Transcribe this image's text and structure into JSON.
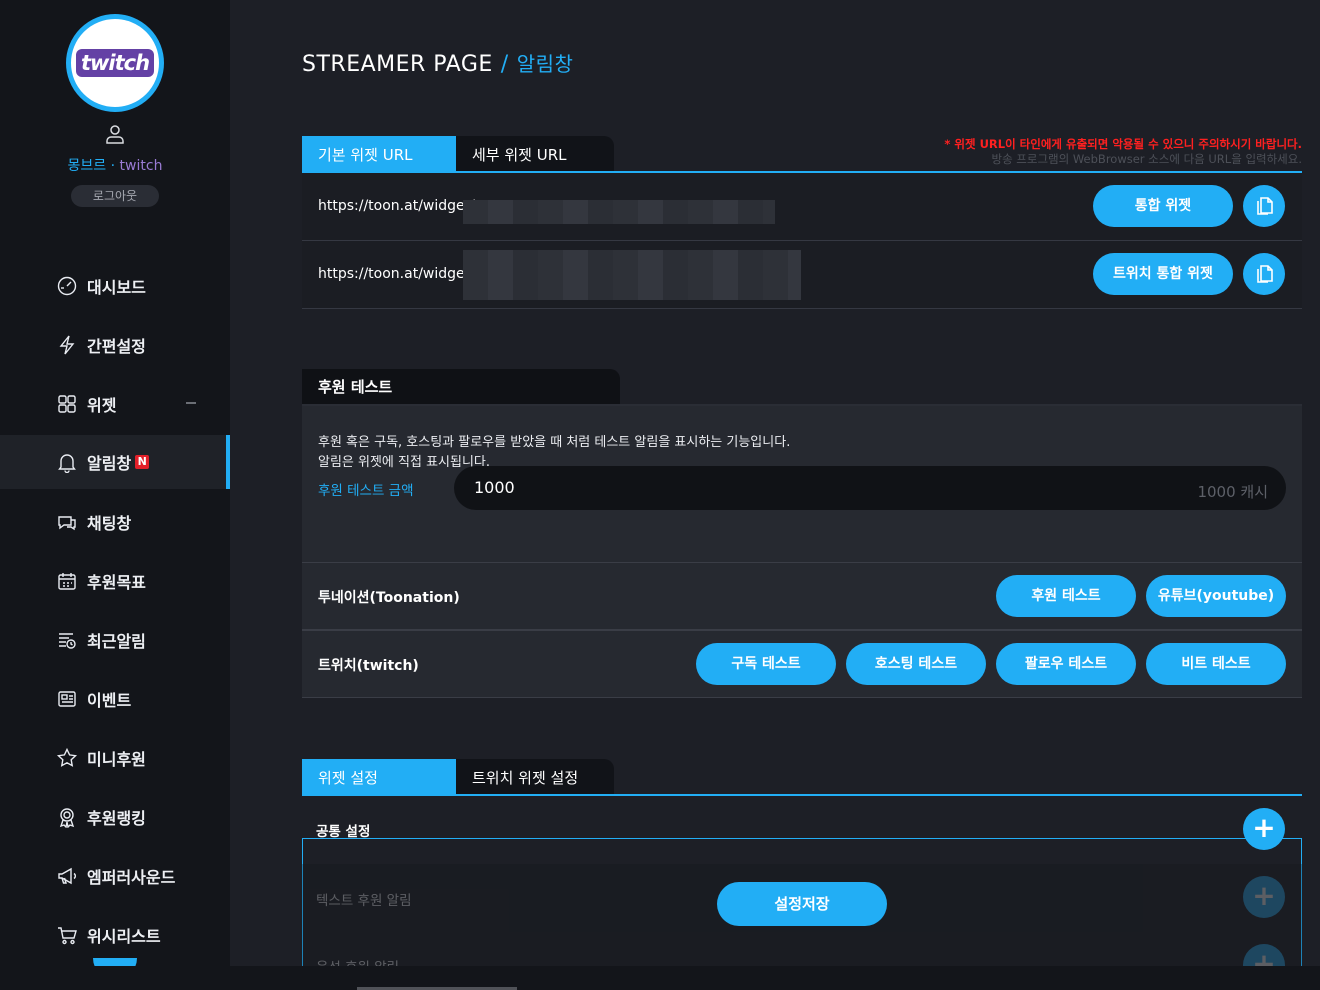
{
  "brand": {
    "logo_text": "twitch",
    "accent": "#22aef5",
    "twitch_purple": "#6441a5"
  },
  "user": {
    "name": "몽브르",
    "separator": "·",
    "platform": "twitch",
    "logout": "로그아웃"
  },
  "nav": [
    {
      "label": "대시보드",
      "icon": "dashboard-icon"
    },
    {
      "label": "간편설정",
      "icon": "lightning-icon"
    },
    {
      "label": "위젯",
      "icon": "widget-grid-icon",
      "collapsible": true
    },
    {
      "label": "알림창",
      "icon": "bell-icon",
      "active": true,
      "badge": "N"
    },
    {
      "label": "채팅창",
      "icon": "chat-icon"
    },
    {
      "label": "후원목표",
      "icon": "calendar-icon"
    },
    {
      "label": "최근알림",
      "icon": "list-icon"
    },
    {
      "label": "이벤트",
      "icon": "newspaper-icon"
    },
    {
      "label": "미니후원",
      "icon": "star-icon"
    },
    {
      "label": "후원랭킹",
      "icon": "award-icon"
    },
    {
      "label": "엠퍼러사운드",
      "icon": "megaphone-icon"
    },
    {
      "label": "위시리스트",
      "icon": "cart-icon"
    }
  ],
  "header": {
    "title": "STREAMER PAGE",
    "separator": "/",
    "current": "알림창"
  },
  "url_section": {
    "tabs": [
      "기본 위젯 URL",
      "세부 위젯 URL"
    ],
    "warning": "* 위젯 URL이 타인에게 유출되면 악용될 수 있으니 주의하시기 바랍니다.",
    "hint": "방송 프로그램의 WebBrowser 소스에 다음 URL을 입력하세요.",
    "rows": [
      {
        "url": "https://toon.at/widget/",
        "button": "통합 위젯"
      },
      {
        "url": "https://toon.at/widget/",
        "button": "트위치 통합 위젯"
      }
    ]
  },
  "test_section": {
    "title": "후원 테스트",
    "desc_line1": "후원 혹은 구독, 호스팅과 팔로우를 받았을 때 처럼 테스트 알림을 표시하는 기능입니다.",
    "desc_line2": "알림은 위젯에 직접 표시됩니다.",
    "amount_label": "후원 테스트 금액",
    "amount_value": "1000",
    "amount_unit": "1000 캐시",
    "toonation": {
      "label": "투네이션(Toonation)",
      "buttons": [
        "후원 테스트",
        "유튜브(youtube)"
      ]
    },
    "twitch": {
      "label": "트위치(twitch)",
      "buttons": [
        "구독 테스트",
        "호스팅 테스트",
        "팔로우 테스트",
        "비트 테스트"
      ]
    }
  },
  "widget_settings": {
    "tabs": [
      "위젯 설정",
      "트위치 위젯 설정"
    ],
    "rows": [
      "공통 설정",
      "텍스트 후원 알림",
      "음성 후원 알림"
    ],
    "save": "설정저장"
  }
}
